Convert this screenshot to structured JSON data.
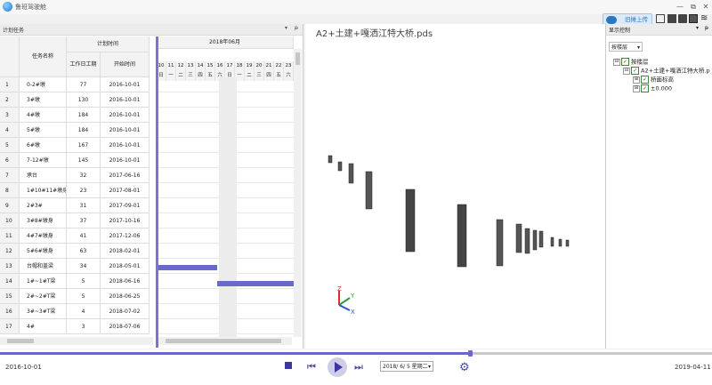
{
  "window": {
    "title": "鲁班驾驶舱",
    "controls": [
      "—",
      "⧉",
      "✕"
    ]
  },
  "upload": {
    "label": "旧摊上传"
  },
  "left_panel": {
    "title": "计划任务",
    "controls": [
      "▾",
      "ᵽ"
    ],
    "columns": {
      "task_name": "任务名称",
      "plan_time": "计划时间",
      "duration": "工作日工期",
      "start": "开始时间"
    },
    "month": "2018年06月",
    "days": [
      "10",
      "11",
      "12",
      "13",
      "14",
      "15",
      "16",
      "17",
      "18",
      "19",
      "20",
      "21",
      "22",
      "23"
    ],
    "weekdays": [
      "日",
      "一",
      "二",
      "三",
      "四",
      "五",
      "六",
      "日",
      "一",
      "二",
      "三",
      "四",
      "五",
      "六"
    ],
    "rows": [
      {
        "no": "1",
        "name": "0-2#墩",
        "duration": "77",
        "start": "2016-10-01"
      },
      {
        "no": "2",
        "name": "3#墩",
        "duration": "130",
        "start": "2016-10-01"
      },
      {
        "no": "3",
        "name": "4#墩",
        "duration": "184",
        "start": "2016-10-01"
      },
      {
        "no": "4",
        "name": "5#墩",
        "duration": "184",
        "start": "2016-10-01"
      },
      {
        "no": "5",
        "name": "6#墩",
        "duration": "167",
        "start": "2016-10-01"
      },
      {
        "no": "6",
        "name": "7-12#墩",
        "duration": "145",
        "start": "2016-10-01"
      },
      {
        "no": "7",
        "name": "承台",
        "duration": "32",
        "start": "2017-06-16"
      },
      {
        "no": "8",
        "name": "1#10#11#墩身",
        "duration": "23",
        "start": "2017-08-01"
      },
      {
        "no": "9",
        "name": "2#3#",
        "duration": "31",
        "start": "2017-09-01"
      },
      {
        "no": "10",
        "name": "3#8#墩身",
        "duration": "37",
        "start": "2017-10-16"
      },
      {
        "no": "11",
        "name": "4#7#墩身",
        "duration": "41",
        "start": "2017-12-06"
      },
      {
        "no": "12",
        "name": "5#6#墩身",
        "duration": "63",
        "start": "2018-02-01"
      },
      {
        "no": "13",
        "name": "台帽和盖梁",
        "duration": "34",
        "start": "2018-05-01"
      },
      {
        "no": "14",
        "name": "1#~1#T梁",
        "duration": "5",
        "start": "2018-06-16"
      },
      {
        "no": "15",
        "name": "2#~2#T梁",
        "duration": "5",
        "start": "2018-06-25"
      },
      {
        "no": "16",
        "name": "3#~3#T梁",
        "duration": "4",
        "start": "2018-07-02"
      },
      {
        "no": "17",
        "name": "4#",
        "duration": "3",
        "start": "2018-07-06"
      }
    ]
  },
  "viewport": {
    "model_title": "A2+土建+嘎洒江特大桥.pds",
    "axis_labels": {
      "z": "Z",
      "y": "Y",
      "x": "X"
    }
  },
  "right_panel": {
    "title": "显示控制",
    "controls": [
      "▾",
      "ᵽ"
    ],
    "layer_select": "按楼层",
    "tree": [
      {
        "label": "按楼层",
        "level": 0,
        "expander": "⊟"
      },
      {
        "label": "A2+土建+嘎洒江特大桥.p",
        "level": 1,
        "expander": "⊟"
      },
      {
        "label": "桥面标高",
        "level": 2,
        "expander": "⊞"
      },
      {
        "label": "±0.000",
        "level": 2,
        "expander": "⊞"
      }
    ]
  },
  "timeline": {
    "start_date": "2016-10-01",
    "end_date": "2019-04-11",
    "progress": 0.66,
    "current_date": "2018/ 6/ 5 星期二",
    "colors": {
      "accent": "#6d66c9",
      "bar": "#6a68c8"
    }
  }
}
